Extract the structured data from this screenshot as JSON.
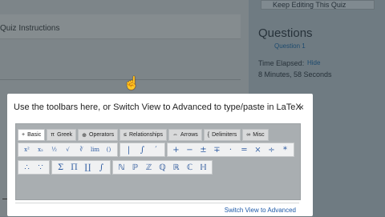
{
  "background": {
    "band_text": "Quiz Instructions",
    "keep_editing": "Keep Editing This Quiz",
    "questions_heading": "Questions",
    "question_item": "Question 1",
    "time_elapsed": "Time Elapsed:",
    "hide_label": "Hide",
    "time_value": "8 Minutes, 58 Seconds"
  },
  "modal": {
    "title": "Use the toolbars here, or Switch View to Advanced to type/paste in LaTeX",
    "close": "×",
    "switch_link": "Switch View to Advanced"
  },
  "tabs": [
    {
      "glyph": "+",
      "label": "Basic"
    },
    {
      "glyph": "π",
      "label": "Greek"
    },
    {
      "glyph": "⊕",
      "label": "Operators"
    },
    {
      "glyph": "≤",
      "label": "Relationships"
    },
    {
      "glyph": "⇔",
      "label": "Arrows"
    },
    {
      "glyph": "{",
      "label": "Delimiters"
    },
    {
      "glyph": "∞",
      "label": "Misc"
    }
  ],
  "row1": {
    "g1": [
      "x²",
      "x₂",
      "½",
      "√",
      "∛",
      "lim",
      "()"
    ],
    "g2": [
      "|",
      "∫",
      "′"
    ],
    "g3": [
      "+",
      "−",
      "±",
      "∓",
      "·",
      "=",
      "×",
      "÷",
      "*"
    ]
  },
  "row2": {
    "g1": [
      "∴",
      "∵"
    ],
    "g2": [
      "Σ",
      "Π",
      "∐",
      "∫"
    ],
    "g3": [
      "ℕ",
      "ℙ",
      "ℤ",
      "ℚ",
      "ℝ",
      "ℂ",
      "ℍ"
    ]
  }
}
